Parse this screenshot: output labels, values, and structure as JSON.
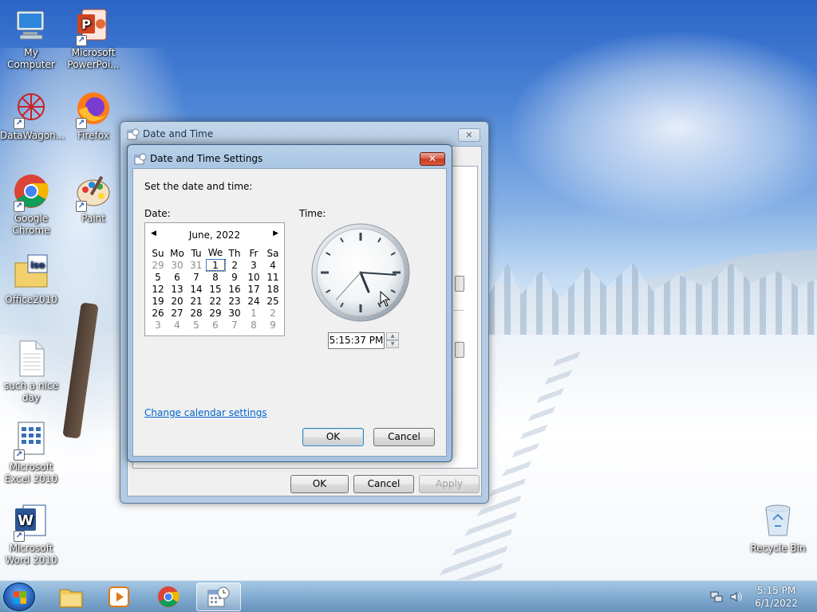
{
  "desktop": {
    "icons": [
      {
        "label": "My Computer"
      },
      {
        "label": "Microsoft PowerPoi..."
      },
      {
        "label": "DataWagon..."
      },
      {
        "label": "Firefox"
      },
      {
        "label": "Google Chrome"
      },
      {
        "label": "Paint"
      },
      {
        "label": "Office2010"
      },
      {
        "label": "such a nice day"
      },
      {
        "label": "Microsoft Excel 2010"
      },
      {
        "label": "Microsoft Word 2010"
      },
      {
        "label": "Recycle Bin"
      }
    ],
    "iso_badge": "iso"
  },
  "outer_dialog": {
    "title": "Date and Time",
    "close_glyph": "✕",
    "ok": "OK",
    "cancel": "Cancel",
    "apply": "Apply"
  },
  "inner_dialog": {
    "title": "Date and Time Settings",
    "close_glyph": "✕",
    "prompt": "Set the date and time:",
    "date_label": "Date:",
    "time_label": "Time:",
    "calendar": {
      "month_year": "June, 2022",
      "prev": "◀",
      "next": "▶",
      "weekdays": [
        "Su",
        "Mo",
        "Tu",
        "We",
        "Th",
        "Fr",
        "Sa"
      ],
      "weeks": [
        [
          "29",
          "30",
          "31",
          "1",
          "2",
          "3",
          "4"
        ],
        [
          "5",
          "6",
          "7",
          "8",
          "9",
          "10",
          "11"
        ],
        [
          "12",
          "13",
          "14",
          "15",
          "16",
          "17",
          "18"
        ],
        [
          "19",
          "20",
          "21",
          "22",
          "23",
          "24",
          "25"
        ],
        [
          "26",
          "27",
          "28",
          "29",
          "30",
          "1",
          "2"
        ],
        [
          "3",
          "4",
          "5",
          "6",
          "7",
          "8",
          "9"
        ]
      ],
      "selected": "1"
    },
    "clock": {
      "hour": 5,
      "minute": 15,
      "second": 37
    },
    "time_value": "5:15:37 PM",
    "change_calendar_link": "Change calendar settings",
    "ok": "OK",
    "cancel": "Cancel"
  },
  "taskbar": {
    "time": "5:15 PM",
    "date": "6/1/2022"
  }
}
